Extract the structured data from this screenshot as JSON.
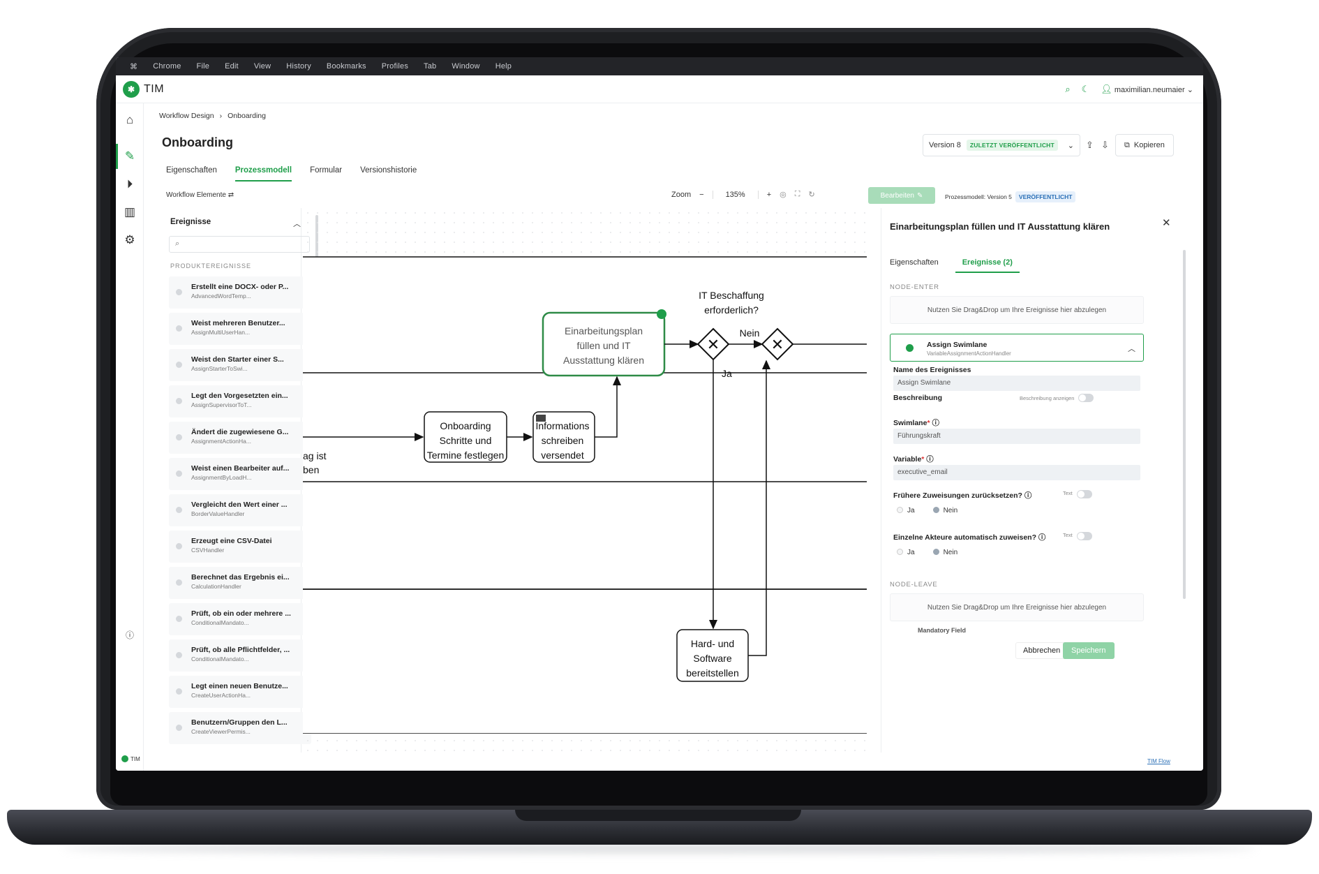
{
  "menubar": [
    "Chrome",
    "File",
    "Edit",
    "View",
    "History",
    "Bookmarks",
    "Profiles",
    "Tab",
    "Window",
    "Help"
  ],
  "app": {
    "name": "TIM",
    "user": "maximilian.neumaier"
  },
  "breadcrumb": [
    "Workflow Design",
    "Onboarding"
  ],
  "page_title": "Onboarding",
  "version": {
    "label": "Version 8",
    "badge": "ZULETZT VERÖFFENTLICHT"
  },
  "copy_label": "Kopieren",
  "tabs": [
    "Eigenschaften",
    "Prozessmodell",
    "Formular",
    "Versionshistorie"
  ],
  "toolbar": {
    "workflow_elements": "Workflow Elemente",
    "zoom_label": "Zoom",
    "zoom_value": "135%",
    "edit_label": "Bearbeiten",
    "pm_label": "Prozessmodell: Version 5",
    "pm_badge": "VERÖFFENTLICHT"
  },
  "events_panel": {
    "header": "Ereignisse",
    "section": "PRODUKTEREIGNISSE",
    "items": [
      {
        "title": "Erstellt eine DOCX- oder P...",
        "sub": "AdvancedWordTemp..."
      },
      {
        "title": "Weist mehreren Benutzer...",
        "sub": "AssignMultiUserHan..."
      },
      {
        "title": "Weist den Starter einer S...",
        "sub": "AssignStarterToSwi..."
      },
      {
        "title": "Legt den Vorgesetzten ein...",
        "sub": "AssignSupervisorToT..."
      },
      {
        "title": "Ändert die zugewiesene G...",
        "sub": "AssignmentActionHa..."
      },
      {
        "title": "Weist einen Bearbeiter auf...",
        "sub": "AssignmentByLoadH..."
      },
      {
        "title": "Vergleicht den Wert einer ...",
        "sub": "BorderValueHandler"
      },
      {
        "title": "Erzeugt eine CSV-Datei",
        "sub": "CSVHandler"
      },
      {
        "title": "Berechnet das Ergebnis ei...",
        "sub": "CalculationHandler"
      },
      {
        "title": "Prüft, ob ein oder mehrere ...",
        "sub": "ConditionalMandato..."
      },
      {
        "title": "Prüft, ob alle Pflichtfelder, ...",
        "sub": "ConditionalMandato..."
      },
      {
        "title": "Legt einen neuen Benutze...",
        "sub": "CreateUserActionHa..."
      },
      {
        "title": "Benutzern/Gruppen den L...",
        "sub": "CreateViewerPermis..."
      }
    ]
  },
  "diagram": {
    "task_main": [
      "Einarbeitungsplan",
      "füllen und IT",
      "Ausstattung klären"
    ],
    "gateway_label": [
      "IT Beschaffung",
      "erforderlich?"
    ],
    "nein": "Nein",
    "ja": "Ja",
    "task_onboarding": [
      "Onboarding",
      "Schritte und",
      "Termine festlegen"
    ],
    "task_mail": [
      "Informations",
      "schreiben",
      "versendet"
    ],
    "task_hardware": [
      "Hard- und",
      "Software",
      "bereitstellen"
    ],
    "partial_a": "ag  ist",
    "partial_b": "ben"
  },
  "properties": {
    "title": "Einarbeitungsplan füllen und IT Ausstattung klären",
    "tabs": [
      "Eigenschaften",
      "Ereignisse (2)"
    ],
    "node_enter": "NODE-ENTER",
    "node_leave": "NODE-LEAVE",
    "dropzone": "Nutzen Sie Drag&Drop um Ihre Ereignisse hier abzulegen",
    "event": {
      "title": "Assign Swimlane",
      "sub": "VariableAssignmentActionHandler"
    },
    "name_label": "Name des Ereignisses",
    "name_value": "Assign Swimlane",
    "desc_label": "Beschreibung",
    "desc_toggle": "Beschreibung anzeigen",
    "swimlane_label": "Swimlane",
    "swimlane_value": "Führungskraft",
    "variable_label": "Variable",
    "variable_value": "executive_email",
    "q1": "Frühere Zuweisungen zurücksetzen?",
    "q2": "Einzelne Akteure automatisch zuweisen?",
    "text_label": "Text",
    "ja": "Ja",
    "nein": "Nein",
    "next_partial": "Mandatory Field",
    "cancel": "Abbrechen",
    "save": "Speichern"
  },
  "footer_link": "TIM Flow",
  "footer_logo": "TIM",
  "colors": {
    "accent": "#1f9e4a",
    "badge_blue": "#2a6fb6"
  }
}
